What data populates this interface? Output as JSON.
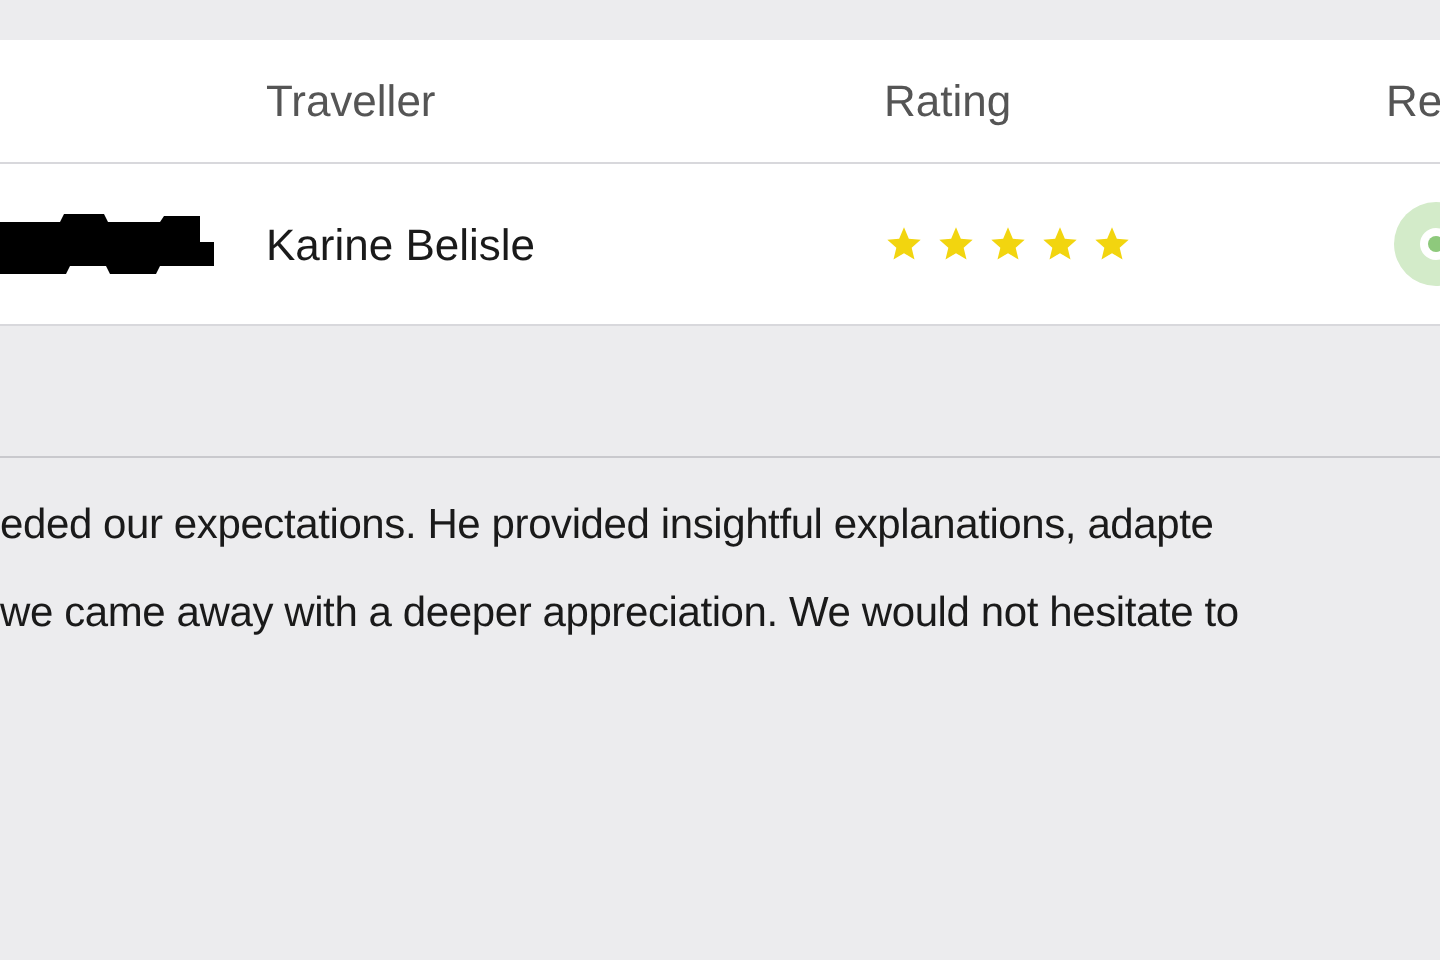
{
  "table": {
    "columns": [
      "Traveller",
      "Rating",
      "Re"
    ],
    "rows": [
      {
        "traveller": "Karine Belisle",
        "stars": 5,
        "redacted": true
      }
    ]
  },
  "review": {
    "lines": [
      "eded our expectations. He provided insightful explanations, adapte",
      "we came away with a deeper appreciation. We would not hesitate to"
    ]
  }
}
